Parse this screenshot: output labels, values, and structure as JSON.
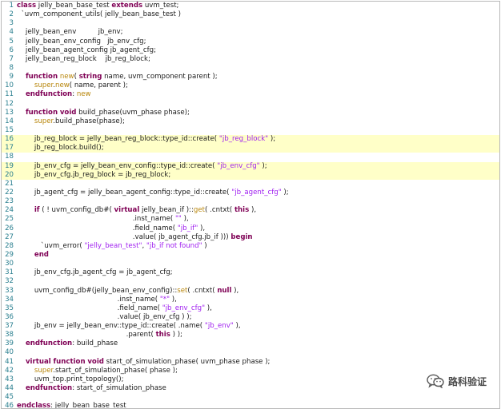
{
  "editor": {
    "lines": [
      {
        "n": "1",
        "hl": false,
        "segs": [
          [
            "k",
            "class"
          ],
          [
            "p",
            " jelly_bean_base_test "
          ],
          [
            "k",
            "extends"
          ],
          [
            "p",
            " uvm_test;"
          ]
        ]
      },
      {
        "n": "2",
        "hl": false,
        "segs": [
          [
            "p",
            "  `uvm_component_utils( jelly_bean_base_test )"
          ]
        ]
      },
      {
        "n": "3",
        "hl": false,
        "segs": [
          [
            "p",
            ""
          ]
        ]
      },
      {
        "n": "4",
        "hl": false,
        "segs": [
          [
            "p",
            "    jelly_bean_env          jb_env;"
          ]
        ]
      },
      {
        "n": "5",
        "hl": false,
        "segs": [
          [
            "p",
            "    jelly_bean_env_config   jb_env_cfg;"
          ]
        ]
      },
      {
        "n": "6",
        "hl": false,
        "segs": [
          [
            "p",
            "    jelly_bean_agent_config jb_agent_cfg;"
          ]
        ]
      },
      {
        "n": "7",
        "hl": false,
        "segs": [
          [
            "p",
            "    jelly_bean_reg_block    jb_reg_block;"
          ]
        ]
      },
      {
        "n": "8",
        "hl": false,
        "segs": [
          [
            "p",
            ""
          ]
        ]
      },
      {
        "n": "9",
        "hl": false,
        "segs": [
          [
            "p",
            "    "
          ],
          [
            "k",
            "function"
          ],
          [
            "p",
            " "
          ],
          [
            "f",
            "new"
          ],
          [
            "p",
            "( "
          ],
          [
            "k",
            "string"
          ],
          [
            "p",
            " name, uvm_component parent );"
          ]
        ]
      },
      {
        "n": "10",
        "hl": false,
        "segs": [
          [
            "p",
            "        "
          ],
          [
            "f",
            "super"
          ],
          [
            "p",
            "."
          ],
          [
            "f",
            "new"
          ],
          [
            "p",
            "( name, parent );"
          ]
        ]
      },
      {
        "n": "11",
        "hl": false,
        "segs": [
          [
            "p",
            "    "
          ],
          [
            "k",
            "endfunction"
          ],
          [
            "p",
            ": "
          ],
          [
            "f",
            "new"
          ]
        ]
      },
      {
        "n": "12",
        "hl": false,
        "segs": [
          [
            "p",
            ""
          ]
        ]
      },
      {
        "n": "13",
        "hl": false,
        "segs": [
          [
            "p",
            "    "
          ],
          [
            "k",
            "function"
          ],
          [
            "p",
            " "
          ],
          [
            "k",
            "void"
          ],
          [
            "p",
            " build_phase(uvm_phase phase);"
          ]
        ]
      },
      {
        "n": "14",
        "hl": false,
        "segs": [
          [
            "p",
            "        "
          ],
          [
            "f",
            "super"
          ],
          [
            "p",
            ".build_phase(phase);"
          ]
        ]
      },
      {
        "n": "15",
        "hl": false,
        "segs": [
          [
            "p",
            ""
          ]
        ]
      },
      {
        "n": "16",
        "hl": true,
        "segs": [
          [
            "p",
            "        jb_reg_block = jelly_bean_reg_block::type_id::create( "
          ],
          [
            "s",
            "\"jb_reg_block\""
          ],
          [
            "p",
            " );"
          ]
        ]
      },
      {
        "n": "17",
        "hl": true,
        "segs": [
          [
            "p",
            "        jb_reg_block.build();"
          ]
        ]
      },
      {
        "n": "18",
        "hl": false,
        "segs": [
          [
            "p",
            ""
          ]
        ]
      },
      {
        "n": "19",
        "hl": true,
        "segs": [
          [
            "p",
            "        jb_env_cfg = jelly_bean_env_config::type_id::create( "
          ],
          [
            "s",
            "\"jb_env_cfg\""
          ],
          [
            "p",
            " );"
          ]
        ]
      },
      {
        "n": "20",
        "hl": true,
        "segs": [
          [
            "p",
            "        jb_env_cfg.jb_reg_block = jb_reg_block;"
          ]
        ]
      },
      {
        "n": "21",
        "hl": false,
        "segs": [
          [
            "p",
            ""
          ]
        ]
      },
      {
        "n": "22",
        "hl": false,
        "segs": [
          [
            "p",
            "        jb_agent_cfg = jelly_bean_agent_config::type_id::create( "
          ],
          [
            "s",
            "\"jb_agent_cfg\""
          ],
          [
            "p",
            " );"
          ]
        ]
      },
      {
        "n": "23",
        "hl": false,
        "segs": [
          [
            "p",
            ""
          ]
        ]
      },
      {
        "n": "24",
        "hl": false,
        "segs": [
          [
            "p",
            "        "
          ],
          [
            "k",
            "if"
          ],
          [
            "p",
            " ( ! uvm_config_db#( "
          ],
          [
            "k",
            "virtual"
          ],
          [
            "p",
            " jelly_bean_if )::"
          ],
          [
            "f",
            "get"
          ],
          [
            "p",
            "( .cntxt( "
          ],
          [
            "k",
            "this"
          ],
          [
            "p",
            " ),"
          ]
        ]
      },
      {
        "n": "25",
        "hl": false,
        "segs": [
          [
            "p",
            "                                                     .inst_name( "
          ],
          [
            "s",
            "\"\""
          ],
          [
            "p",
            " ),"
          ]
        ]
      },
      {
        "n": "26",
        "hl": false,
        "segs": [
          [
            "p",
            "                                                     .field_name( "
          ],
          [
            "s",
            "\"jb_if\""
          ],
          [
            "p",
            " ),"
          ]
        ]
      },
      {
        "n": "27",
        "hl": false,
        "segs": [
          [
            "p",
            "                                                     .value( jb_agent_cfg.jb_if ))) "
          ],
          [
            "k",
            "begin"
          ]
        ]
      },
      {
        "n": "28",
        "hl": false,
        "segs": [
          [
            "p",
            "           `uvm_error( "
          ],
          [
            "s",
            "\"jelly_bean_test\""
          ],
          [
            "p",
            ", "
          ],
          [
            "s",
            "\"jb_if not found\""
          ],
          [
            "p",
            " )"
          ]
        ]
      },
      {
        "n": "29",
        "hl": false,
        "segs": [
          [
            "p",
            "        "
          ],
          [
            "k",
            "end"
          ]
        ]
      },
      {
        "n": "30",
        "hl": false,
        "segs": [
          [
            "p",
            ""
          ]
        ]
      },
      {
        "n": "31",
        "hl": false,
        "segs": [
          [
            "p",
            "        jb_env_cfg.jb_agent_cfg = jb_agent_cfg;"
          ]
        ]
      },
      {
        "n": "32",
        "hl": false,
        "segs": [
          [
            "p",
            ""
          ]
        ]
      },
      {
        "n": "33",
        "hl": false,
        "segs": [
          [
            "p",
            "        uvm_config_db#(jelly_bean_env_config)::"
          ],
          [
            "f",
            "set"
          ],
          [
            "p",
            "( .cntxt( "
          ],
          [
            "k",
            "null"
          ],
          [
            "p",
            " ),"
          ]
        ]
      },
      {
        "n": "34",
        "hl": false,
        "segs": [
          [
            "p",
            "                                              .inst_name( "
          ],
          [
            "s",
            "\"*\""
          ],
          [
            "p",
            " ),"
          ]
        ]
      },
      {
        "n": "35",
        "hl": false,
        "segs": [
          [
            "p",
            "                                              .field_name( "
          ],
          [
            "s",
            "\"jb_env_cfg\""
          ],
          [
            "p",
            " ),"
          ]
        ]
      },
      {
        "n": "36",
        "hl": false,
        "segs": [
          [
            "p",
            "                                              .value( jb_env_cfg ) );"
          ]
        ]
      },
      {
        "n": "37",
        "hl": false,
        "segs": [
          [
            "p",
            "        jb_env = jelly_bean_env::type_id::create( .name( "
          ],
          [
            "s",
            "\"jb_env\""
          ],
          [
            "p",
            " ),"
          ]
        ]
      },
      {
        "n": "38",
        "hl": false,
        "segs": [
          [
            "p",
            "                                                  .parent( "
          ],
          [
            "k",
            "this"
          ],
          [
            "p",
            " ) );"
          ]
        ]
      },
      {
        "n": "39",
        "hl": false,
        "segs": [
          [
            "p",
            "    "
          ],
          [
            "k",
            "endfunction"
          ],
          [
            "p",
            ": build_phase"
          ]
        ]
      },
      {
        "n": "40",
        "hl": false,
        "segs": [
          [
            "p",
            ""
          ]
        ]
      },
      {
        "n": "41",
        "hl": false,
        "segs": [
          [
            "p",
            "    "
          ],
          [
            "k",
            "virtual"
          ],
          [
            "p",
            " "
          ],
          [
            "k",
            "function"
          ],
          [
            "p",
            " "
          ],
          [
            "k",
            "void"
          ],
          [
            "p",
            " start_of_simulation_phase( uvm_phase phase );"
          ]
        ]
      },
      {
        "n": "42",
        "hl": false,
        "segs": [
          [
            "p",
            "        "
          ],
          [
            "f",
            "super"
          ],
          [
            "p",
            ".start_of_simulation_phase( phase );"
          ]
        ]
      },
      {
        "n": "43",
        "hl": false,
        "segs": [
          [
            "p",
            "        uvm_top.print_topology();"
          ]
        ]
      },
      {
        "n": "44",
        "hl": false,
        "segs": [
          [
            "p",
            "    "
          ],
          [
            "k",
            "endfunction"
          ],
          [
            "p",
            ": start_of_simulation_phase"
          ]
        ]
      },
      {
        "n": "45",
        "hl": false,
        "segs": [
          [
            "p",
            ""
          ]
        ]
      },
      {
        "n": "46",
        "hl": false,
        "segs": [
          [
            "k",
            "endclass"
          ],
          [
            "p",
            ": jelly_bean_base_test"
          ]
        ]
      }
    ]
  },
  "watermark": {
    "text": "路科验证",
    "icon": "wechat-logo-icon"
  }
}
